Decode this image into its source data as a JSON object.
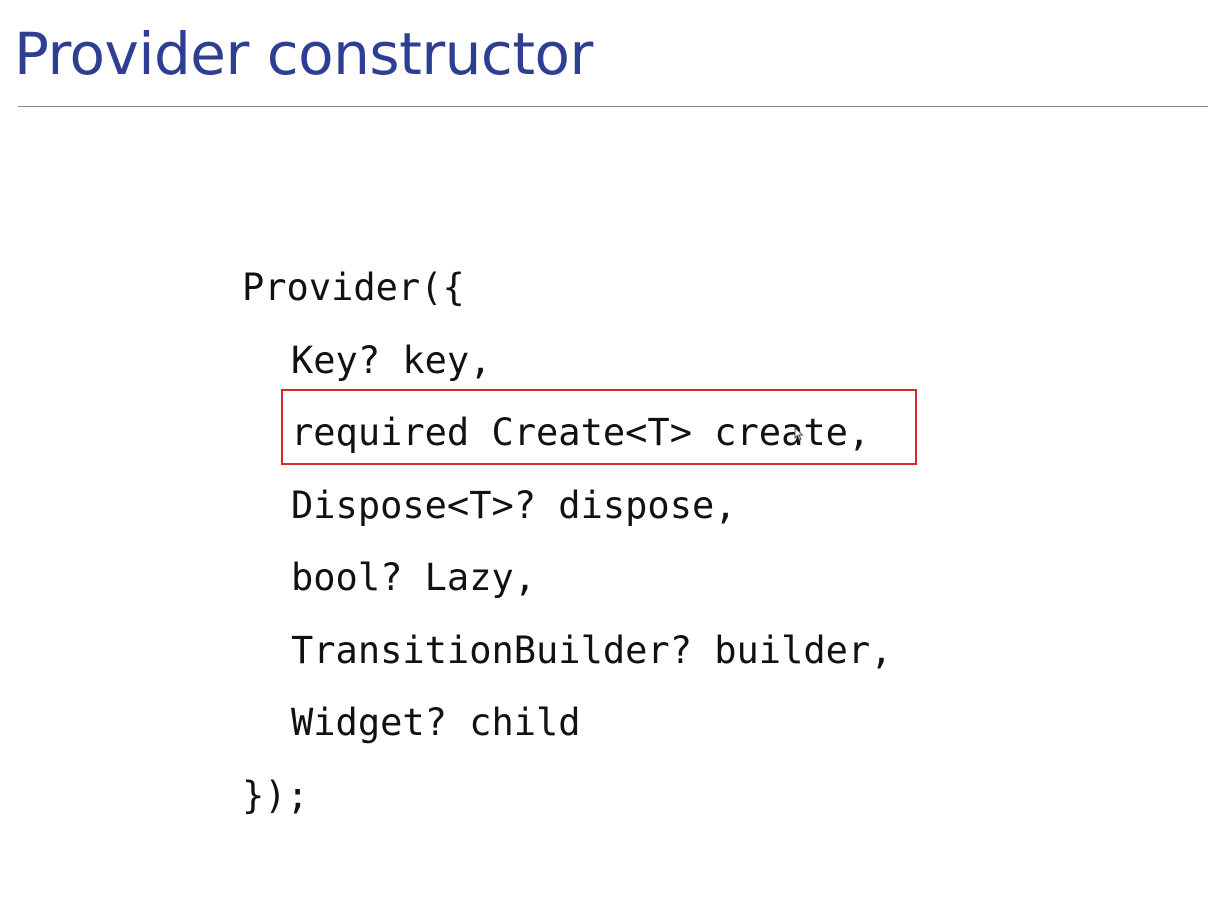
{
  "slide": {
    "title": "Provider constructor"
  },
  "code": {
    "lines": [
      "Provider({",
      "Key? key,",
      "required Create<T> create,",
      "Dispose<T>? dispose,",
      "bool? Lazy,",
      "TransitionBuilder? builder,",
      "Widget? child",
      "});"
    ],
    "highlighted_line": "required Create<T> create,"
  },
  "colors": {
    "title": "#2e3f93",
    "highlight_border": "#d42b2b",
    "code_text": "#111111",
    "rule": "#8a8a8a"
  },
  "icons": {
    "cursor": "mouse-pointer-icon"
  }
}
